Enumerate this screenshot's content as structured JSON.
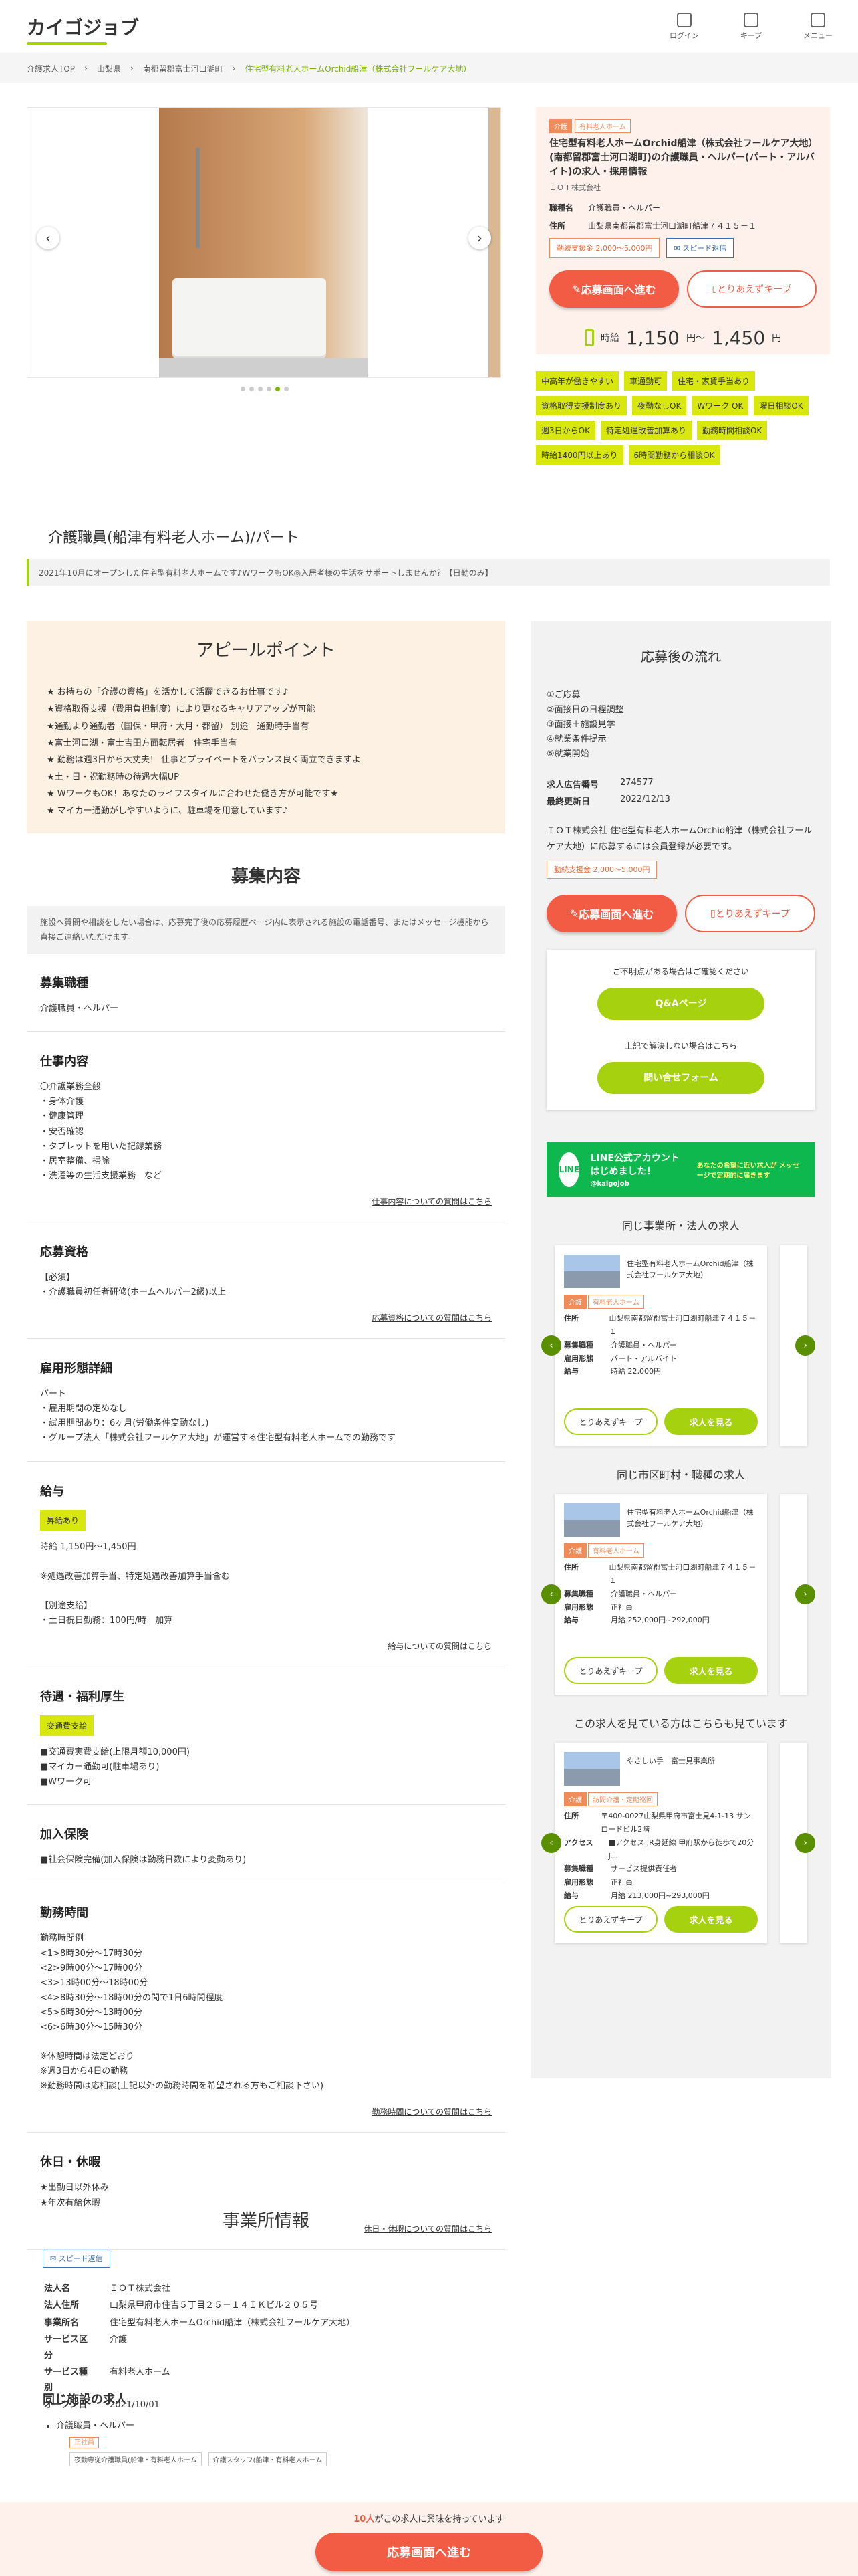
{
  "header": {
    "logo": "カイゴジョブ",
    "login": "ログイン",
    "keep": "キープ",
    "menu": "メニュー"
  },
  "breadcrumb": [
    "介護求人TOP",
    "山梨県",
    "南都留郡富士河口湖町",
    "住宅型有料老人ホームOrchid船津（株式会社フールケア大地）"
  ],
  "job": {
    "tags": [
      "介護",
      "有料老人ホーム"
    ],
    "title": "住宅型有料老人ホームOrchid船津（株式会社フールケア大地）(南都留郡富士河口湖町)の介護職員・ヘルパー(パート・アルバイト)の求人・採用情報",
    "company": "ＩＯＴ株式会社",
    "role_label": "職種名",
    "role": "介護職員・ヘルパー",
    "addr_label": "住所",
    "addr": "山梨県南都留郡富士河口湖町船津７４１５－１",
    "bonus": "勤続支援金 2,000～5,000円",
    "speedy": "スピード返信",
    "apply": "応募画面へ進む",
    "keep": "とりあえずキープ",
    "wage_label": "時給",
    "wage_from": "1,150",
    "wage_to": "1,450",
    "wage_sep": "円～",
    "wage_unit": "円"
  },
  "chips": [
    "中高年が働きやすい",
    "車通勤可",
    "住宅・家賃手当あり",
    "資格取得支援制度あり",
    "夜勤なしOK",
    "Wワーク OK",
    "曜日相談OK",
    "週3日からOK",
    "特定処遇改善加算あり",
    "勤務時間相談OK",
    "時給1400円以上あり",
    "6時間勤務から相談OK"
  ],
  "page_title": "介護職員(船津有料老人ホーム)/パート",
  "lead": "2021年10月にオープンした住宅型有料老人ホームです♪WワークもOK◎入居者様の生活をサポートしませんか？【日勤のみ】",
  "appeal": {
    "title": "アピールポイント",
    "lines": [
      "★ お持ちの「介護の資格」を活かして活躍できるお仕事です♪",
      "★資格取得支援（費用負担制度）により更なるキャリアアップが可能",
      "★通勤より通勤者（国保・甲府・大月・都留） 別途　通勤時手当有",
      "★富士河口湖・富士吉田方面転居者　住宅手当有",
      "★ 勤務は週3日から大丈夫！ 仕事とプライベートをバランス良く両立できますよ",
      "★土・日・祝勤務時の待遇大幅UP",
      "★ WワークもOK！あなたのライフスタイルに合わせた働き方が可能です★",
      "★ マイカー通勤がしやすいように、駐車場を用意しています♪"
    ]
  },
  "recruit": {
    "title": "募集内容",
    "note": "施設へ質問や相談をしたい場合は、応募完了後の応募履歴ページ内に表示される施設の電話番号、またはメッセージ機能から直接ご連絡いただけます。",
    "blocks": [
      {
        "h": "募集職種",
        "lines": [
          "介護職員・ヘルパー"
        ],
        "more": ""
      },
      {
        "h": "仕事内容",
        "lines": [
          "〇介護業務全般",
          "・身体介護",
          "・健康管理",
          "・安否確認",
          "・タブレットを用いた記録業務",
          "・居室整備、掃除",
          "・洗濯等の生活支援業務　など"
        ],
        "more": "仕事内容についての質問はこちら"
      },
      {
        "h": "応募資格",
        "lines": [
          "【必須】",
          "・介護職員初任者研修(ホームヘルパー2級)以上"
        ],
        "more": "応募資格についての質問はこちら"
      },
      {
        "h": "雇用形態詳細",
        "lines": [
          "パート",
          "・雇用期間の定めなし",
          "・試用期間あり：6ヶ月(労働条件変動なし)",
          "・グループ法人「株式会社フールケア大地」が運営する住宅型有料老人ホームでの勤務です"
        ],
        "more": ""
      },
      {
        "h": "給与",
        "badge": "昇給あり",
        "lines": [
          "時給 1,150円～1,450円",
          "",
          "※処遇改善加算手当、特定処遇改善加算手当含む",
          "",
          "【別途支給】",
          "・土日祝日勤務：100円/時　加算"
        ],
        "more": "給与についての質問はこちら"
      },
      {
        "h": "待遇・福利厚生",
        "badge": "交通費支給",
        "lines": [
          "■交通費実費支給(上限月額10,000円)",
          "■マイカー通勤可(駐車場あり)",
          "■Wワーク可"
        ],
        "more": ""
      },
      {
        "h": "加入保険",
        "lines": [
          "■社会保険完備(加入保険は勤務日数により変動あり)"
        ],
        "more": ""
      },
      {
        "h": "勤務時間",
        "lines": [
          "勤務時間例",
          "<1>8時30分～17時30分",
          "<2>9時00分～17時00分",
          "<3>13時00分～18時00分",
          "<4>8時30分～18時00分の間で1日6時間程度",
          "<5>6時30分～13時00分",
          "<6>6時30分～15時30分",
          "",
          "※休憩時間は法定どおり",
          "※週3日から4日の勤務",
          "※勤務時間は応相談(上記以外の勤務時間を希望される方もご相談下さい)"
        ],
        "more": "勤務時間についての質問はこちら"
      },
      {
        "h": "休日・休暇",
        "lines": [
          "★出勤日以外休み",
          "★年次有給休暇"
        ],
        "more": "休日・休暇についての質問はこちら"
      }
    ]
  },
  "flow": {
    "title": "応募後の流れ",
    "steps": [
      "①ご応募",
      "②面接日の日程調整",
      "③面接＋施設見学",
      "④就業条件提示",
      "⑤就業開始"
    ],
    "ad_no_label": "求人広告番号",
    "ad_no": "274577",
    "updated_label": "最終更新日",
    "updated": "2022/12/13",
    "text": "ＩＯＴ株式会社 住宅型有料老人ホームOrchid船津（株式会社フールケア大地）に応募するには会員登録が必要です。",
    "bonus": "勤続支援金 2,000～5,000円"
  },
  "qa": {
    "q1": "ご不明点がある場合はご確認ください",
    "btn1": "Q&Aページ",
    "q2": "上記で解決しない場合はこちら",
    "btn2": "問い合せフォーム"
  },
  "line": {
    "badge": "LINE",
    "title": "LINE公式アカウント はじめました！",
    "id": "@kaigojob",
    "note": "あなたの希望に近い求人が メッセージで定期的に届きます"
  },
  "similar": [
    {
      "h": "同じ事業所・法人の求人",
      "name": "住宅型有料老人ホームOrchid船津（株式会社フールケア大地）",
      "tags": [
        "介護",
        "有料老人ホーム"
      ],
      "rows": [
        [
          "住所",
          "山梨県南都留郡富士河口湖町船津７４１５－１"
        ],
        [
          "募集職種",
          "介護職員・ヘルパー"
        ],
        [
          "雇用形態",
          "パート・アルバイト"
        ],
        [
          "給与",
          "時給 22,000円"
        ]
      ]
    },
    {
      "h": "同じ市区町村・職種の求人",
      "name": "住宅型有料老人ホームOrchid船津（株式会社フールケア大地）",
      "tags": [
        "介護",
        "有料老人ホーム"
      ],
      "rows": [
        [
          "住所",
          "山梨県南都留郡富士河口湖町船津７４１５－１"
        ],
        [
          "募集職種",
          "介護職員・ヘルパー"
        ],
        [
          "雇用形態",
          "正社員"
        ],
        [
          "給与",
          "月給 252,000円~292,000円"
        ]
      ]
    },
    {
      "h": "この求人を見ている方はこちらも見ています",
      "name": "やさしい手　富士見事業所",
      "tags": [
        "介護",
        "訪問介護・定期巡回"
      ],
      "rows": [
        [
          "住所",
          "〒400-0027山梨県甲府市富士見4-1-13 サンロードビル2階"
        ],
        [
          "アクセス",
          "■アクセス JR身延線 甲府駅から徒歩で20分 J..."
        ],
        [
          "募集職種",
          "サービス提供責任者"
        ],
        [
          "雇用形態",
          "正社員"
        ],
        [
          "給与",
          "月給 213,000円~293,000円"
        ]
      ]
    }
  ],
  "card_keep": "とりあえずキープ",
  "card_see": "求人を見る",
  "office": {
    "title": "事業所情報",
    "speedy": "スピード返信",
    "rows": [
      [
        "法人名",
        "ＩＯＴ株式会社"
      ],
      [
        "法人住所",
        "山梨県甲府市住吉５丁目２５－１４ＩＫビル２０５号"
      ],
      [
        "事業所名",
        "住宅型有料老人ホームOrchid船津（株式会社フールケア大地）"
      ],
      [
        "サービス区分",
        "介護"
      ],
      [
        "サービス種別",
        "有料老人ホーム"
      ],
      [
        "オープン日",
        "2021/10/01"
      ]
    ]
  },
  "same_facility": {
    "title": "同じ施設の求人",
    "item": "介護職員・ヘルパー",
    "tag": "正社員",
    "sub1": "夜勤専従介護職員(船津・有料老人ホーム",
    "sub2": "介護スタッフ(船津・有料老人ホーム"
  },
  "footer": {
    "count": "10人",
    "text": "がこの求人に興味を持っています",
    "apply": "応募画面へ進む"
  }
}
